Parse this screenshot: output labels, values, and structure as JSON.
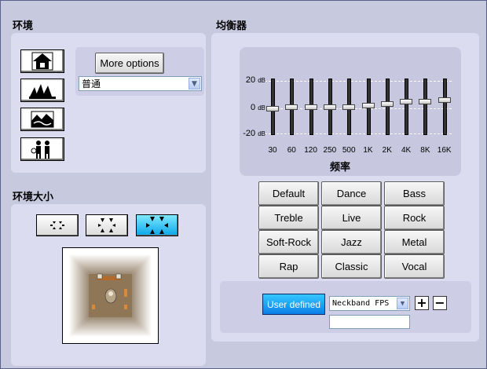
{
  "environment": {
    "title": "环境",
    "more_options_label": "More options",
    "env_select_value": "普通",
    "icons": [
      "house-icon",
      "opera-house-icon",
      "landscape-icon",
      "people-icon"
    ]
  },
  "env_size": {
    "title": "环境大小",
    "selected_index": 2
  },
  "equalizer": {
    "title": "均衡器",
    "db_top": "20",
    "db_mid": "0",
    "db_bottom": "-20",
    "db_unit": "dB",
    "freq_axis_label": "频率",
    "bands": [
      "30",
      "60",
      "120",
      "250",
      "500",
      "1K",
      "2K",
      "4K",
      "8K",
      "16K"
    ],
    "levels_db": [
      -1,
      0,
      0,
      0,
      0,
      1,
      2,
      4,
      4,
      5
    ],
    "presets": [
      [
        "Default",
        "Dance",
        "Bass"
      ],
      [
        "Treble",
        "Live",
        "Rock"
      ],
      [
        "Soft-Rock",
        "Jazz",
        "Metal"
      ],
      [
        "Rap",
        "Classic",
        "Vocal"
      ]
    ],
    "user_defined_label": "User defined",
    "user_select_value": "Neckband FPS",
    "plus_label": "+",
    "minus_label": "−",
    "name_input_value": ""
  },
  "colors": {
    "background": "#c7c9df",
    "panel": "#dcdcf0",
    "active_blue": "#0aa6e8"
  }
}
